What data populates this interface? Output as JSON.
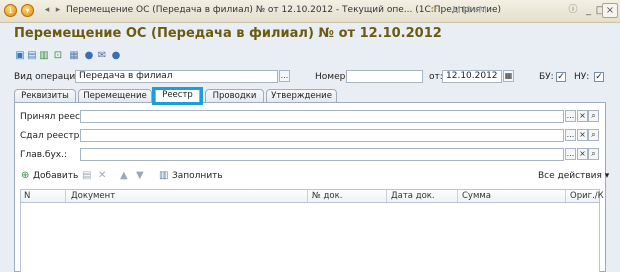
{
  "window": {
    "title": "Перемещение ОС (Передача в филиал) № от 12.10.2012 - Текущий опе...  (1С:Предприятие)",
    "buttons": {
      "m": "M",
      "mplus": "M+",
      "mminus": "M-",
      "minimize": "_",
      "restore": "□",
      "close": "×"
    }
  },
  "form": {
    "title": "Перемещение ОС (Передача в филиал) № от 12.10.2012"
  },
  "header": {
    "operation_label": "Вид операции:",
    "operation_value": "Передача в филиал",
    "number_label": "Номер:",
    "number_value": "",
    "date_label": "от:",
    "date_value": "12.10.2012",
    "bu_label": "БУ:",
    "nu_label": "НУ:"
  },
  "tabs": [
    {
      "label": "Реквизиты",
      "active": false
    },
    {
      "label": "Перемещение",
      "active": false
    },
    {
      "label": "Реестр",
      "active": true
    },
    {
      "label": "Проводки",
      "active": false
    },
    {
      "label": "Утверждение",
      "active": false
    }
  ],
  "registry": {
    "accepted_label": "Принял реестр:",
    "accepted_value": "",
    "handed_label": "Сдал реестр:",
    "handed_value": "",
    "chief_label": "Глав.бух.:",
    "chief_value": ""
  },
  "commands": {
    "add": "Добавить",
    "fill": "Заполнить",
    "all_actions": "Все действия"
  },
  "table": {
    "columns": [
      "N",
      "Документ",
      "№ док.",
      "Дата док.",
      "Сумма",
      "Ориг./К"
    ]
  },
  "colors": {
    "title": "#6b5a10",
    "tab_highlight": "#1aa0d8"
  }
}
